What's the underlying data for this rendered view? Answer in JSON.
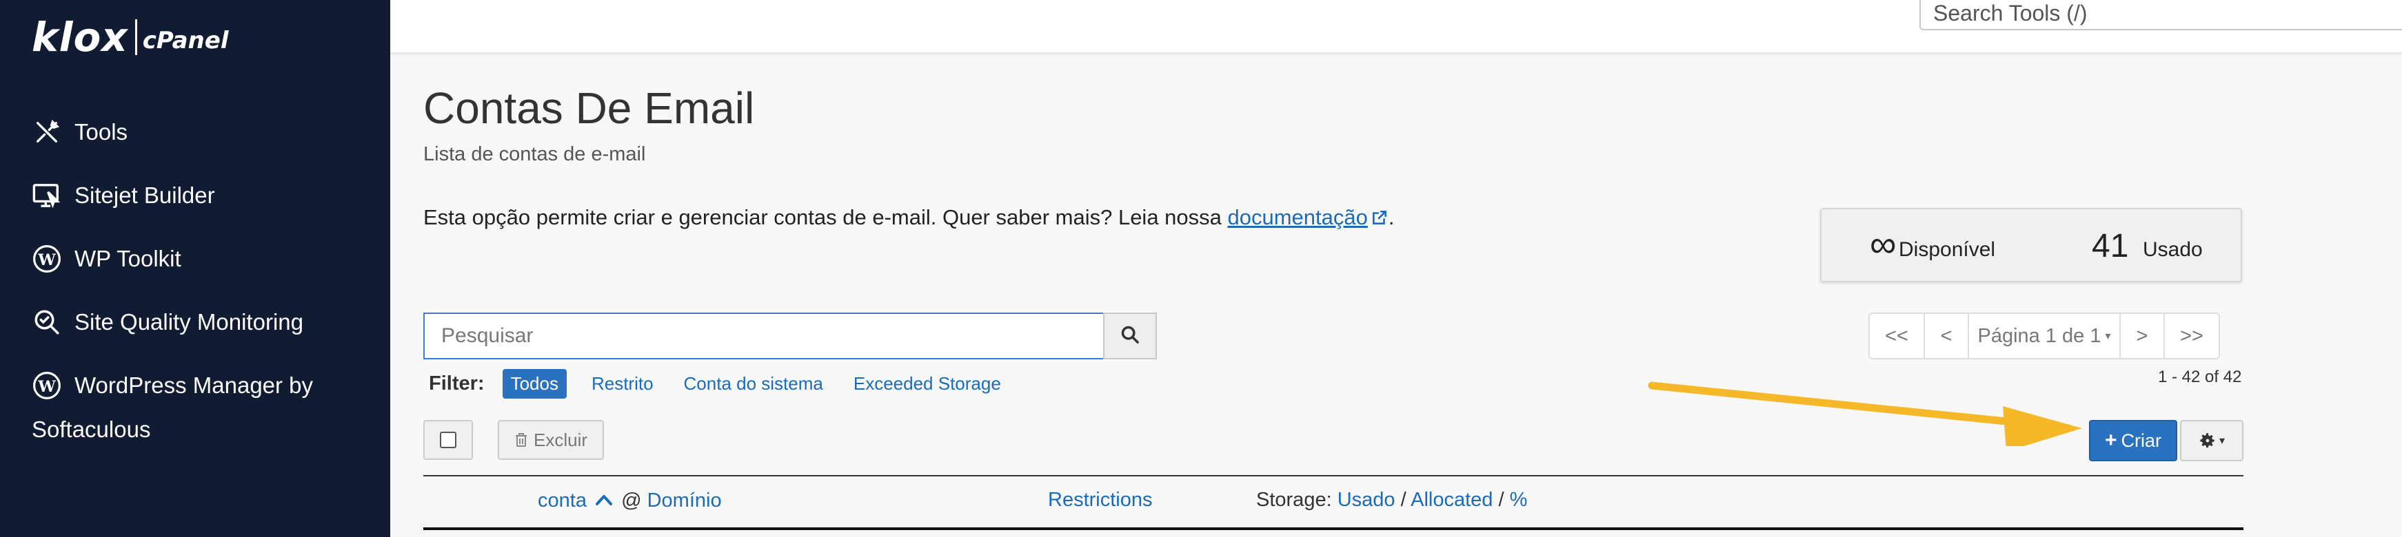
{
  "brand": {
    "name": "klox",
    "product": "cPanel"
  },
  "sidebar": {
    "items": [
      {
        "label": "Tools",
        "icon": "tools-icon"
      },
      {
        "label": "Sitejet Builder",
        "icon": "sitejet-icon"
      },
      {
        "label": "WP Toolkit",
        "icon": "wordpress-icon"
      },
      {
        "label": "Site Quality Monitoring",
        "icon": "site-quality-icon"
      },
      {
        "label_line1": "WordPress Manager by",
        "label_line2": "Softaculous",
        "icon": "wordpress-icon"
      }
    ]
  },
  "topbar": {
    "search_placeholder": "Search Tools (/)"
  },
  "page": {
    "title": "Contas De Email",
    "subtitle": "Lista de contas de e-mail",
    "description": "Esta opção permite criar e gerenciar contas de e-mail. Quer saber mais? Leia nossa ",
    "doc_link": "documentação",
    "doc_suffix": "."
  },
  "quota": {
    "available_symbol": "∞",
    "available_label": "Disponível",
    "used_count": "41",
    "used_label": "Usado"
  },
  "search": {
    "placeholder": "Pesquisar"
  },
  "pagination": {
    "first": "<<",
    "prev": "<",
    "page_label": "Página 1 de 1",
    "next": ">",
    "last": ">>",
    "range": "1 - 42 of 42"
  },
  "filter": {
    "label": "Filter:",
    "options": [
      "Todos",
      "Restrito",
      "Conta do sistema",
      "Exceeded Storage"
    ],
    "active": "Todos"
  },
  "actions": {
    "delete": "Excluir",
    "create": "Criar"
  },
  "table": {
    "col_account": "conta",
    "col_at": "@",
    "col_domain": "Domínio",
    "col_restrictions": "Restrictions",
    "col_storage": "Storage:",
    "col_used": "Usado",
    "col_sep1": "/",
    "col_allocated": "Allocated",
    "col_sep2": "/",
    "col_percent": "%"
  },
  "colors": {
    "sidebar_bg": "#111c33",
    "primary": "#2a72bf",
    "link": "#1a6bb8",
    "annotation_arrow": "#f5b829"
  }
}
